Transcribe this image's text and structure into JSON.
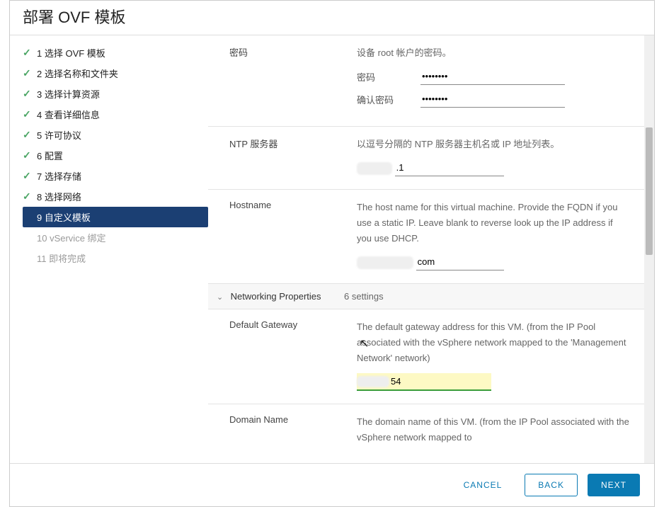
{
  "title": "部署 OVF 模板",
  "sidebar": {
    "items": [
      {
        "label": "1 选择 OVF 模板",
        "state": "done"
      },
      {
        "label": "2 选择名称和文件夹",
        "state": "done"
      },
      {
        "label": "3 选择计算资源",
        "state": "done"
      },
      {
        "label": "4 查看详细信息",
        "state": "done"
      },
      {
        "label": "5 许可协议",
        "state": "done"
      },
      {
        "label": "6 配置",
        "state": "done"
      },
      {
        "label": "7 选择存储",
        "state": "done"
      },
      {
        "label": "8 选择网络",
        "state": "done"
      },
      {
        "label": "9 自定义模板",
        "state": "selected"
      },
      {
        "label": "10 vService 绑定",
        "state": "future"
      },
      {
        "label": "11 即将完成",
        "state": "future"
      }
    ]
  },
  "form": {
    "password": {
      "label": "密码",
      "desc": "设备 root 帐户的密码。",
      "pw_label": "密码",
      "pw_value": "••••••••",
      "confirm_label": "确认密码",
      "confirm_value": "••••••••"
    },
    "ntp": {
      "label": "NTP 服务器",
      "desc": "以逗号分隔的 NTP 服务器主机名或 IP 地址列表。",
      "value_suffix": ".1"
    },
    "hostname": {
      "label": "Hostname",
      "desc": "The host name for this virtual machine. Provide the FQDN if you use a static IP. Leave blank to reverse look up the IP address if you use DHCP.",
      "value_suffix": "com"
    },
    "networking": {
      "section_label": "Networking Properties",
      "section_count": "6 settings"
    },
    "gateway": {
      "label": "Default Gateway",
      "desc": "The default gateway address for this VM. (from the IP Pool associated with the vSphere network mapped to the 'Management Network' network)",
      "value_suffix": "54"
    },
    "domainname": {
      "label": "Domain Name",
      "desc": "The domain name of this VM. (from the IP Pool associated with the vSphere network mapped to"
    }
  },
  "footer": {
    "cancel": "CANCEL",
    "back": "BACK",
    "next": "NEXT"
  }
}
